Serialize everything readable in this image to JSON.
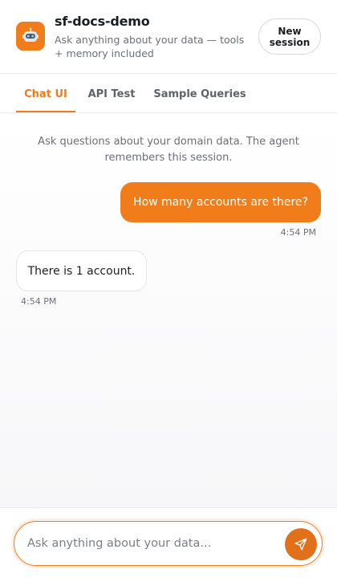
{
  "header": {
    "title": "sf-docs-demo",
    "subtitle": "Ask anything about your data — tools + memory included",
    "new_session_label": "New session",
    "app_icon": "robot-icon"
  },
  "tabs": [
    {
      "label": "Chat UI",
      "active": true
    },
    {
      "label": "API Test",
      "active": false
    },
    {
      "label": "Sample Queries",
      "active": false
    }
  ],
  "chat": {
    "intro": "Ask questions about your domain data. The agent remembers this session.",
    "messages": [
      {
        "role": "user",
        "text": "How many accounts are there?",
        "time": "4:54 PM"
      },
      {
        "role": "assistant",
        "text": "There is 1 account.",
        "time": "4:54 PM"
      }
    ]
  },
  "composer": {
    "placeholder": "Ask anything about your data...",
    "send_icon": "send-icon"
  },
  "colors": {
    "accent": "#f07c1a",
    "text_muted": "#6b6f76"
  }
}
